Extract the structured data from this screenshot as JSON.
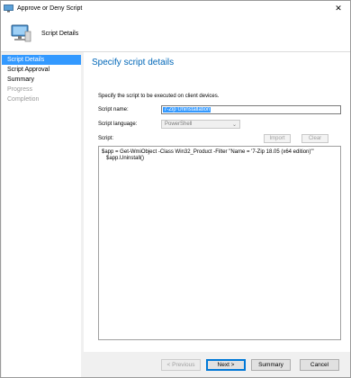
{
  "window": {
    "title": "Approve or Deny Script",
    "close_glyph": "✕",
    "icons": {
      "app": "computer-icon",
      "header": "computer-icon",
      "close": "close-icon"
    }
  },
  "header": {
    "title": "Script Details"
  },
  "sidebar": {
    "items": [
      {
        "label": "Script Details",
        "state": "active"
      },
      {
        "label": "Script Approval",
        "state": "normal"
      },
      {
        "label": "Summary",
        "state": "normal"
      },
      {
        "label": "Progress",
        "state": "disabled"
      },
      {
        "label": "Completion",
        "state": "disabled"
      }
    ]
  },
  "main": {
    "title": "Specify script details",
    "instruction": "Specify the script to be executed on client devices.",
    "script_name_label": "Script name:",
    "script_name_value": "7-Zip Uninstallation",
    "script_language_label": "Script language:",
    "script_language_value": "PowerShell",
    "script_label": "Script:",
    "import_label": "Import",
    "clear_label": "Clear",
    "script_lines": [
      "$app = Get-WmiObject -Class Win32_Product -Filter \"Name = '7-Zip 18.05 (x64 edition)'\"",
      "   $app.Uninstall()"
    ]
  },
  "footer": {
    "previous_label": "< Previous",
    "next_label": "Next >",
    "summary_label": "Summary",
    "cancel_label": "Cancel"
  },
  "colors": {
    "accent": "#3399ff",
    "title_blue": "#0067b8"
  }
}
